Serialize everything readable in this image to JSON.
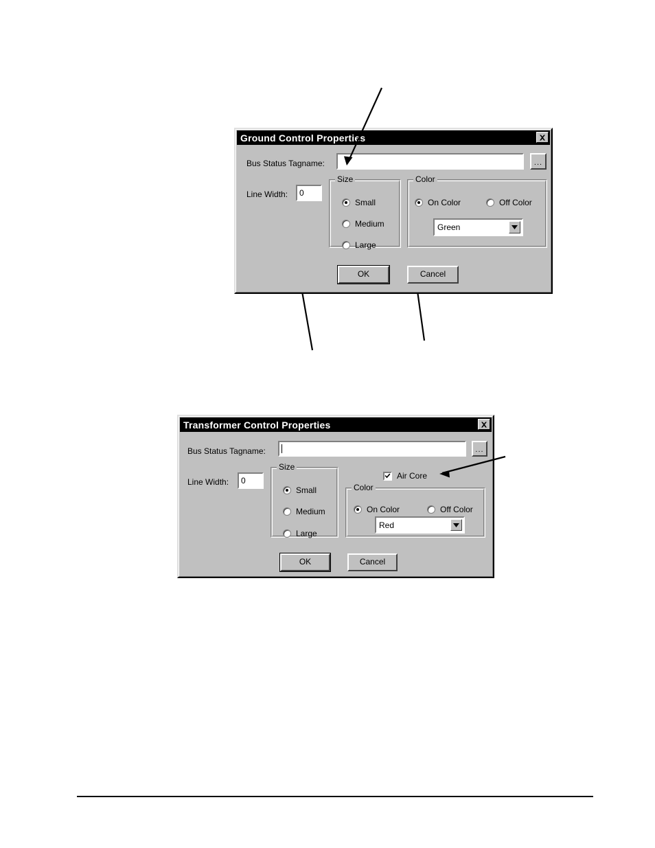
{
  "page": {
    "background": "#ffffff",
    "dialog_face": "#c0c0c0",
    "titlebar_color": "#000000",
    "titlebar_text_color": "#ffffff"
  },
  "dialog_ground": {
    "title": "Ground Control Properties",
    "close_icon": "close-icon",
    "tagname_label": "Bus Status Tagname:",
    "tagname_value": "",
    "tagname_placeholder": "",
    "browse_label": "...",
    "line_width_label": "Line Width:",
    "line_width_value": "0",
    "size_group": {
      "label": "Size",
      "options": [
        {
          "label": "Small",
          "selected": true
        },
        {
          "label": "Medium",
          "selected": false
        },
        {
          "label": "Large",
          "selected": false
        }
      ]
    },
    "color_group": {
      "label": "Color",
      "options": [
        {
          "label": "On Color",
          "selected": true
        },
        {
          "label": "Off Color",
          "selected": false
        }
      ],
      "dropdown_value": "Green",
      "dropdown_arrow_icon": "chevron-down-icon"
    },
    "ok_label": "OK",
    "cancel_label": "Cancel"
  },
  "dialog_transformer": {
    "title": "Transformer Control Properties",
    "close_icon": "close-icon",
    "tagname_label": "Bus Status Tagname:",
    "tagname_value": "",
    "tagname_placeholder": "",
    "browse_label": "...",
    "line_width_label": "Line Width:",
    "line_width_value": "0",
    "air_core_label": "Air Core",
    "air_core_checked": true,
    "size_group": {
      "label": "Size",
      "options": [
        {
          "label": "Small",
          "selected": true
        },
        {
          "label": "Medium",
          "selected": false
        },
        {
          "label": "Large",
          "selected": false
        }
      ]
    },
    "color_group": {
      "label": "Color",
      "options": [
        {
          "label": "On Color",
          "selected": true
        },
        {
          "label": "Off Color",
          "selected": false
        }
      ],
      "dropdown_value": "Red",
      "dropdown_arrow_icon": "chevron-down-icon"
    },
    "ok_label": "OK",
    "cancel_label": "Cancel"
  },
  "annotations": {
    "arrow_to_tagname": "callout-arrow",
    "arrow_to_dialog_body": "callout-arrow",
    "arrow_to_color_group": "callout-arrow",
    "arrow_to_air_core": "callout-arrow"
  }
}
